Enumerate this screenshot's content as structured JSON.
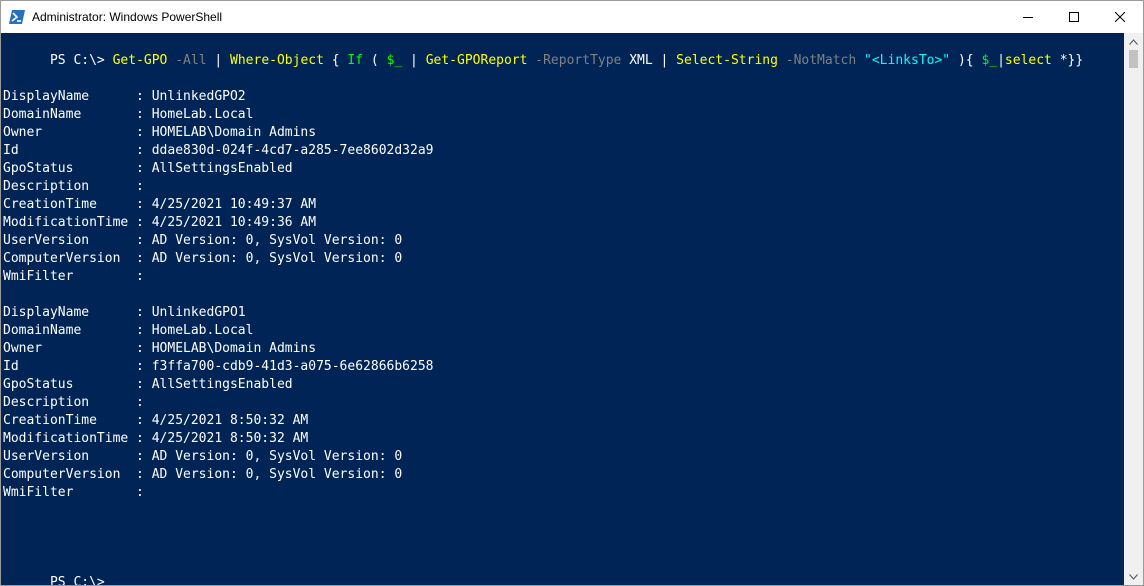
{
  "window": {
    "title": "Administrator: Windows PowerShell",
    "icon": "powershell-icon",
    "controls": [
      "minimize-icon",
      "maximize-icon",
      "close-icon"
    ]
  },
  "console": {
    "command_line": {
      "prompt": "PS C:\\> ",
      "tokens": [
        {
          "text": "Get-GPO",
          "kind": "cmd"
        },
        {
          "text": " ",
          "kind": "text"
        },
        {
          "text": "-All",
          "kind": "param"
        },
        {
          "text": " | ",
          "kind": "text"
        },
        {
          "text": "Where-Object",
          "kind": "cmd"
        },
        {
          "text": " { ",
          "kind": "text"
        },
        {
          "text": "If",
          "kind": "kw"
        },
        {
          "text": " ( ",
          "kind": "text"
        },
        {
          "text": "$_",
          "kind": "var"
        },
        {
          "text": " | ",
          "kind": "text"
        },
        {
          "text": "Get-GPOReport",
          "kind": "cmd"
        },
        {
          "text": " ",
          "kind": "text"
        },
        {
          "text": "-ReportType",
          "kind": "param"
        },
        {
          "text": " XML | ",
          "kind": "text"
        },
        {
          "text": "Select-String",
          "kind": "cmd"
        },
        {
          "text": " ",
          "kind": "text"
        },
        {
          "text": "-NotMatch",
          "kind": "param"
        },
        {
          "text": " ",
          "kind": "text"
        },
        {
          "text": "\"<LinksTo>\"",
          "kind": "str"
        },
        {
          "text": " ){ ",
          "kind": "text"
        },
        {
          "text": "$_",
          "kind": "var"
        },
        {
          "text": "|",
          "kind": "text"
        },
        {
          "text": "select",
          "kind": "cmd"
        },
        {
          "text": " *}}",
          "kind": "text"
        }
      ]
    },
    "records": [
      {
        "rows": [
          {
            "key": "DisplayName",
            "value": "UnlinkedGPO2"
          },
          {
            "key": "DomainName",
            "value": "HomeLab.Local"
          },
          {
            "key": "Owner",
            "value": "HOMELAB\\Domain Admins"
          },
          {
            "key": "Id",
            "value": "ddae830d-024f-4cd7-a285-7ee8602d32a9"
          },
          {
            "key": "GpoStatus",
            "value": "AllSettingsEnabled"
          },
          {
            "key": "Description",
            "value": ""
          },
          {
            "key": "CreationTime",
            "value": "4/25/2021 10:49:37 AM"
          },
          {
            "key": "ModificationTime",
            "value": "4/25/2021 10:49:36 AM"
          },
          {
            "key": "UserVersion",
            "value": "AD Version: 0, SysVol Version: 0"
          },
          {
            "key": "ComputerVersion",
            "value": "AD Version: 0, SysVol Version: 0"
          },
          {
            "key": "WmiFilter",
            "value": ""
          }
        ]
      },
      {
        "rows": [
          {
            "key": "DisplayName",
            "value": "UnlinkedGPO1"
          },
          {
            "key": "DomainName",
            "value": "HomeLab.Local"
          },
          {
            "key": "Owner",
            "value": "HOMELAB\\Domain Admins"
          },
          {
            "key": "Id",
            "value": "f3ffa700-cdb9-41d3-a075-6e62866b6258"
          },
          {
            "key": "GpoStatus",
            "value": "AllSettingsEnabled"
          },
          {
            "key": "Description",
            "value": ""
          },
          {
            "key": "CreationTime",
            "value": "4/25/2021 8:50:32 AM"
          },
          {
            "key": "ModificationTime",
            "value": "4/25/2021 8:50:32 AM"
          },
          {
            "key": "UserVersion",
            "value": "AD Version: 0, SysVol Version: 0"
          },
          {
            "key": "ComputerVersion",
            "value": "AD Version: 0, SysVol Version: 0"
          },
          {
            "key": "WmiFilter",
            "value": ""
          }
        ]
      }
    ],
    "final_prompt": "PS C:\\> "
  },
  "colors": {
    "background": "#012456",
    "cursor": "#fec46a"
  }
}
